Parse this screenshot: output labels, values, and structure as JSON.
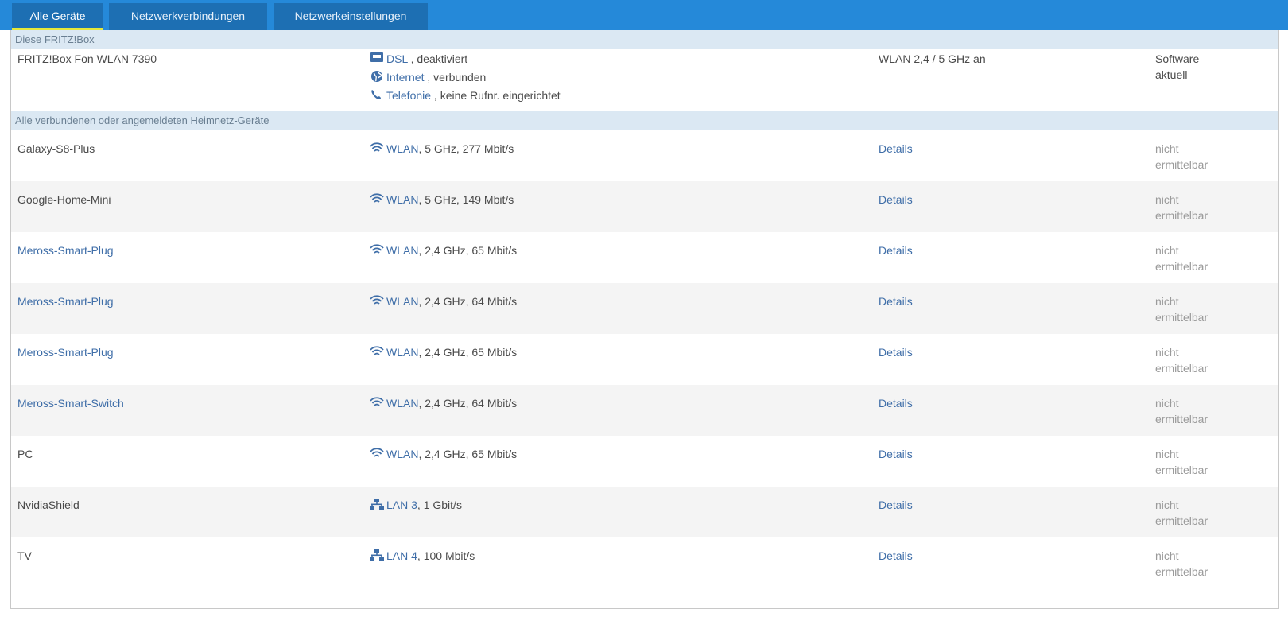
{
  "tabs": [
    {
      "label": "Alle Geräte",
      "active": true
    },
    {
      "label": "Netzwerkverbindungen",
      "active": false
    },
    {
      "label": "Netzwerkeinstellungen",
      "active": false
    }
  ],
  "fritzbox_group": {
    "heading": "Diese FRITZ!Box",
    "name": "FRITZ!Box Fon WLAN 7390",
    "connections": [
      {
        "icon": "dsl-icon",
        "link": "DSL",
        "text": " , deaktiviert"
      },
      {
        "icon": "globe-icon",
        "link": "Internet",
        "text": " , verbunden"
      },
      {
        "icon": "phone-icon",
        "link": "Telefonie",
        "text": " , keine Rufnr. eingerichtet"
      }
    ],
    "property": "WLAN 2,4 / 5 GHz an",
    "status_line1": "Software",
    "status_line2": "aktuell"
  },
  "devices_group": {
    "heading": "Alle verbundenen oder angemeldeten Heimnetz-Geräte",
    "devices": [
      {
        "name": "Galaxy-S8-Plus",
        "name_link": false,
        "icon": "wifi-icon",
        "conn_link": "WLAN",
        "conn_text": ", 5 GHz, 277 Mbit/s",
        "details": "Details",
        "status_line1": "nicht",
        "status_line2": "ermittelbar"
      },
      {
        "name": "Google-Home-Mini",
        "name_link": false,
        "icon": "wifi-icon",
        "conn_link": "WLAN",
        "conn_text": ", 5 GHz, 149 Mbit/s",
        "details": "Details",
        "status_line1": "nicht",
        "status_line2": "ermittelbar"
      },
      {
        "name": "Meross-Smart-Plug",
        "name_link": true,
        "icon": "wifi-icon",
        "conn_link": "WLAN",
        "conn_text": ", 2,4 GHz, 65 Mbit/s",
        "details": "Details",
        "status_line1": "nicht",
        "status_line2": "ermittelbar"
      },
      {
        "name": "Meross-Smart-Plug",
        "name_link": true,
        "icon": "wifi-icon",
        "conn_link": "WLAN",
        "conn_text": ", 2,4 GHz, 64 Mbit/s",
        "details": "Details",
        "status_line1": "nicht",
        "status_line2": "ermittelbar"
      },
      {
        "name": "Meross-Smart-Plug",
        "name_link": true,
        "icon": "wifi-icon",
        "conn_link": "WLAN",
        "conn_text": ", 2,4 GHz, 65 Mbit/s",
        "details": "Details",
        "status_line1": "nicht",
        "status_line2": "ermittelbar"
      },
      {
        "name": "Meross-Smart-Switch",
        "name_link": true,
        "icon": "wifi-icon",
        "conn_link": "WLAN",
        "conn_text": ", 2,4 GHz, 64 Mbit/s",
        "details": "Details",
        "status_line1": "nicht",
        "status_line2": "ermittelbar"
      },
      {
        "name": "PC",
        "name_link": false,
        "icon": "wifi-icon",
        "conn_link": "WLAN",
        "conn_text": ", 2,4 GHz, 65 Mbit/s",
        "details": "Details",
        "status_line1": "nicht",
        "status_line2": "ermittelbar"
      },
      {
        "name": "NvidiaShield",
        "name_link": false,
        "icon": "lan-icon",
        "conn_link": "LAN 3",
        "conn_text": ", 1 Gbit/s",
        "details": "Details",
        "status_line1": "nicht",
        "status_line2": "ermittelbar"
      },
      {
        "name": "TV",
        "name_link": false,
        "icon": "lan-icon",
        "conn_link": "LAN 4",
        "conn_text": ", 100 Mbit/s",
        "details": "Details",
        "status_line1": "nicht",
        "status_line2": "ermittelbar"
      }
    ]
  },
  "colors": {
    "topbar": "#2589d9",
    "tab": "#1d6fb3",
    "active_tab_underline": "#e6e83a",
    "group_header": "#dbe8f3",
    "link": "#3f6ea8",
    "muted": "#9a9a9a"
  }
}
